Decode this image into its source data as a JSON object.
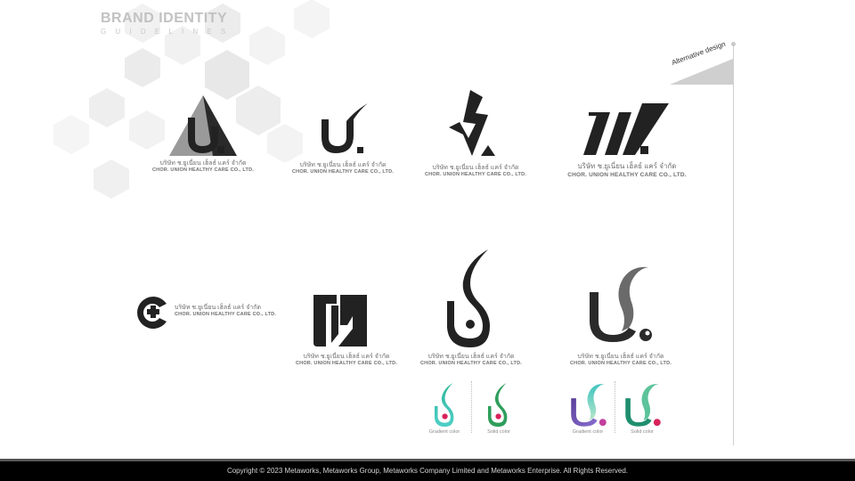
{
  "brand": {
    "title": "BRAND IDENTITY",
    "subtitle": "GUIDELINES"
  },
  "ribbon_label": "Alternative design",
  "company": {
    "name_th": "บริษัท ช.ยูเนี่ยน เฮ็ลธ์ แคร์ จำกัด",
    "name_en": "CHOR. UNION HEALTHY CARE CO., LTD."
  },
  "variants": {
    "gradient_label": "Gradient color",
    "solid_label": "Solid color"
  },
  "colors": {
    "dark": "#222222",
    "gray": "#9a9a9a",
    "teal": "#1f9a86",
    "green": "#3aab62",
    "purple": "#6a4fa0",
    "dot_red": "#d8235a"
  },
  "icons": [
    "triangle-logo-icon",
    "swoosh-logo-icon",
    "lightning-logo-icon",
    "stripes-logo-icon",
    "circle-plus-logo-icon",
    "block-logo-icon",
    "flame-logo-icon",
    "wave-logo-icon"
  ],
  "footer": {
    "copyright": "Copyright © 2023 Metaworks, Metaworks Group, Metaworks Company Limited and Metaworks Enterprise. All Rights Reserved."
  }
}
